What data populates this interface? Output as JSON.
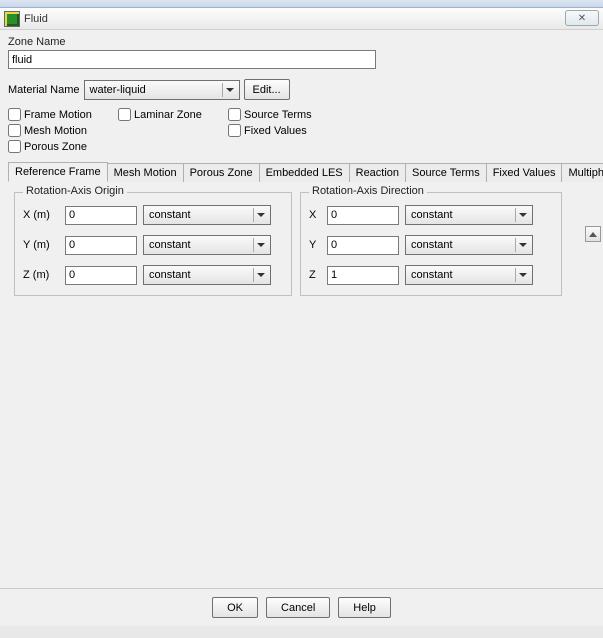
{
  "window": {
    "title": "Fluid",
    "close_glyph": "✕"
  },
  "labels": {
    "zone_name": "Zone Name",
    "material_name": "Material Name"
  },
  "zone_name_value": "fluid",
  "material": {
    "selected": "water-liquid",
    "edit_button": "Edit..."
  },
  "checks": {
    "frame_motion": "Frame Motion",
    "laminar_zone": "Laminar Zone",
    "source_terms": "Source Terms",
    "mesh_motion": "Mesh Motion",
    "fixed_values": "Fixed Values",
    "porous_zone": "Porous Zone"
  },
  "tabs": {
    "reference_frame": "Reference Frame",
    "mesh_motion": "Mesh Motion",
    "porous_zone": "Porous Zone",
    "embedded_les": "Embedded LES",
    "reaction": "Reaction",
    "source_terms": "Source Terms",
    "fixed_values": "Fixed Values",
    "multiphase": "Multiphase"
  },
  "origin": {
    "legend": "Rotation-Axis Origin",
    "xlabel": "X (m)",
    "ylabel": "Y (m)",
    "zlabel": "Z (m)",
    "x": "0",
    "y": "0",
    "z": "0",
    "xmode": "constant",
    "ymode": "constant",
    "zmode": "constant"
  },
  "direction": {
    "legend": "Rotation-Axis Direction",
    "xlabel": "X",
    "ylabel": "Y",
    "zlabel": "Z",
    "x": "0",
    "y": "0",
    "z": "1",
    "xmode": "constant",
    "ymode": "constant",
    "zmode": "constant"
  },
  "footer": {
    "ok": "OK",
    "cancel": "Cancel",
    "help": "Help"
  }
}
